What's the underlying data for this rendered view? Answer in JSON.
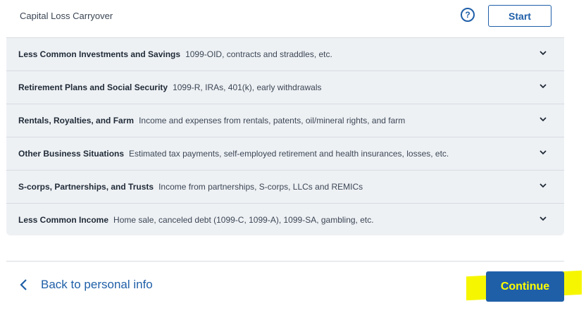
{
  "top_item": {
    "label": "Capital Loss Carryover",
    "help_glyph": "?",
    "start_label": "Start"
  },
  "sections": [
    {
      "title": "Less Common Investments and Savings",
      "description": "1099-OID, contracts and straddles, etc."
    },
    {
      "title": "Retirement Plans and Social Security",
      "description": "1099-R, IRAs, 401(k), early withdrawals"
    },
    {
      "title": "Rentals, Royalties, and Farm",
      "description": "Income and expenses from rentals, patents, oil/mineral rights, and farm"
    },
    {
      "title": "Other Business Situations",
      "description": "Estimated tax payments, self-employed retirement and health insurances, losses, etc."
    },
    {
      "title": "S-corps, Partnerships, and Trusts",
      "description": "Income from partnerships, S-corps, LLCs and REMICs"
    },
    {
      "title": "Less Common Income",
      "description": "Home sale, canceled debt (1099-C, 1099-A), 1099-SA, gambling, etc."
    }
  ],
  "footer": {
    "back_label": "Back to personal info",
    "continue_label": "Continue"
  },
  "colors": {
    "accent": "#1f5fa8",
    "accordion_bg": "#eef1f4",
    "highlight": "#f6f600"
  },
  "icons": {
    "help": "question-circle-icon",
    "expand": "chevron-down-icon",
    "back": "chevron-left-icon"
  }
}
